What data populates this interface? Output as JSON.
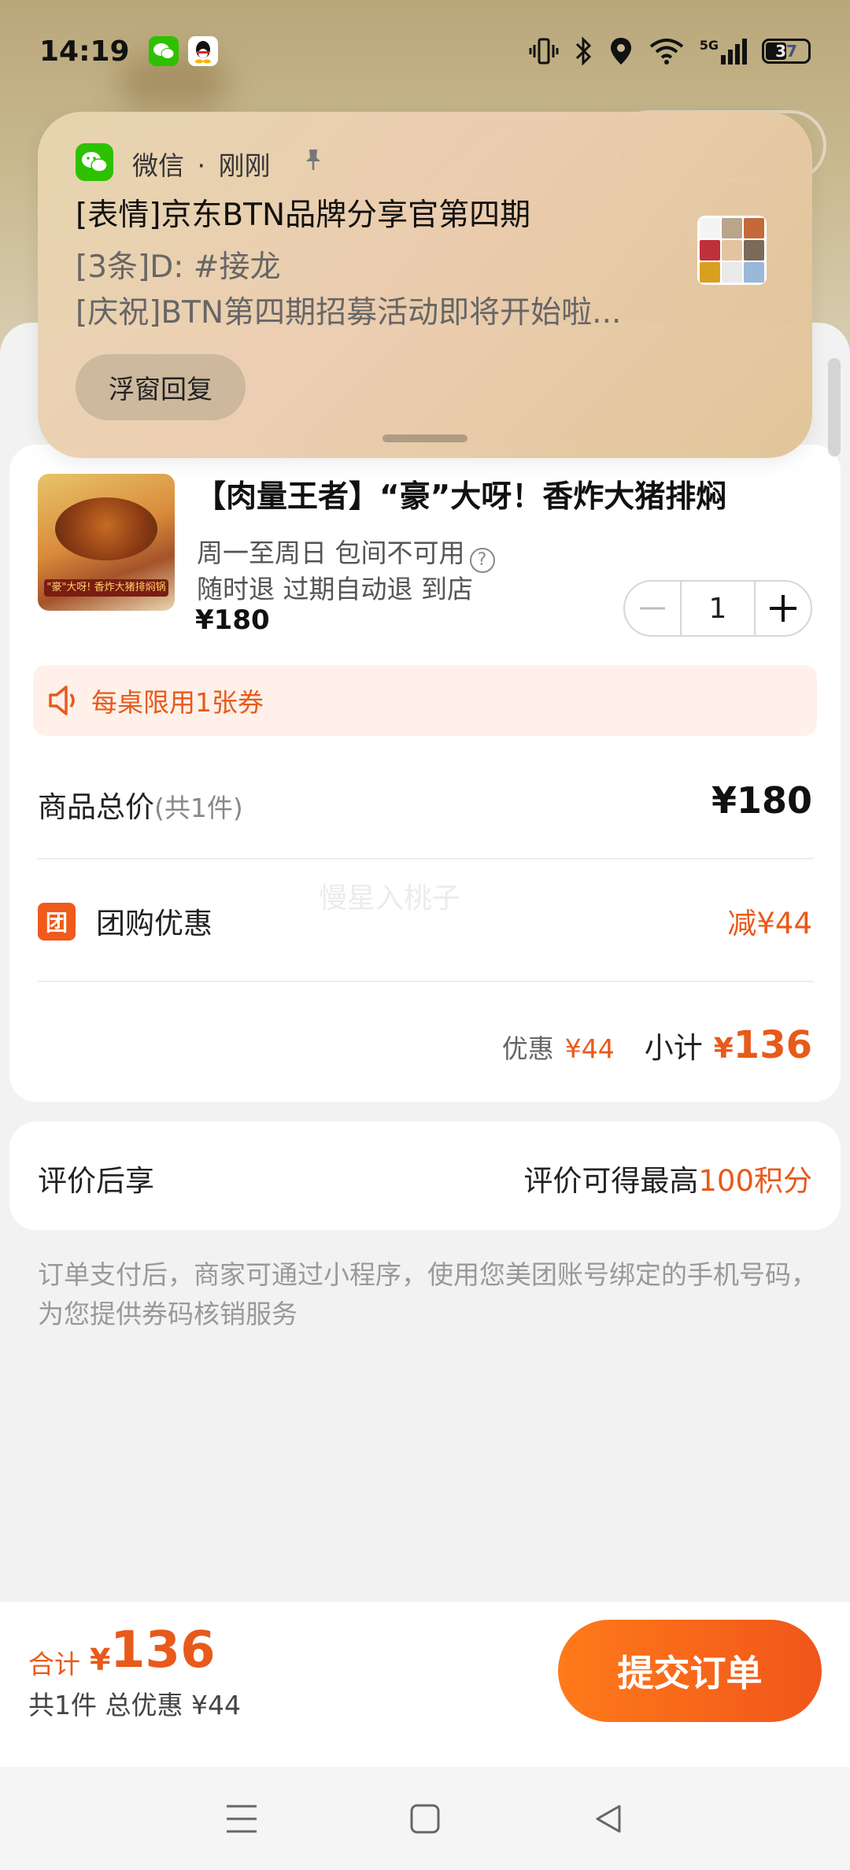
{
  "status_bar": {
    "time": "14:19",
    "network": "5G",
    "battery": "37"
  },
  "notification": {
    "app_name": "微信",
    "separator": "·",
    "time": "刚刚",
    "title": "[表情]京东BTN品牌分享官第四期",
    "line1": "[3条]D: #接龙",
    "line2": "[庆祝]BTN第四期招募活动即将开始啦...",
    "reply_button": "浮窗回复"
  },
  "product": {
    "image_banner": "\"豪\"大呀! 香炸大猪排焖锅",
    "title": "【肉量王者】“豪”大呀！香炸大猪排焖",
    "availability": "周一至周日 包间不可用",
    "refund": "随时退 过期自动退 到店",
    "price": "¥180",
    "quantity": "1"
  },
  "notice": {
    "text": "每桌限用1张券"
  },
  "summary": {
    "total_label": "商品总价",
    "total_count": "(共1件)",
    "total_value": "¥180",
    "group_icon": "团",
    "group_label": "团购优惠",
    "group_value": "减¥44",
    "discount_label": "优惠",
    "discount_value": "¥44",
    "subtotal_label": "小计",
    "subtotal_yen": "¥",
    "subtotal_value": "136"
  },
  "watermark": "慢星入桃子",
  "review": {
    "label": "评价后享",
    "value_prefix": "评价可得最高",
    "value_highlight": "100积分"
  },
  "disclaimer": "订单支付后，商家可通过小程序，使用您美团账号绑定的手机号码，为您提供券码核销服务",
  "bottom": {
    "total_label": "合计",
    "total_yen": "¥",
    "total_amount": "136",
    "total_sub": "共1件 总优惠 ¥44",
    "submit": "提交订单"
  },
  "icons": {
    "wechat": "wechat-icon",
    "qq": "qq-icon",
    "pin": "pin-icon",
    "speaker": "speaker-icon",
    "help": "help-icon"
  },
  "colors": {
    "accent": "#f05a1a",
    "wechat": "#2dc100"
  }
}
